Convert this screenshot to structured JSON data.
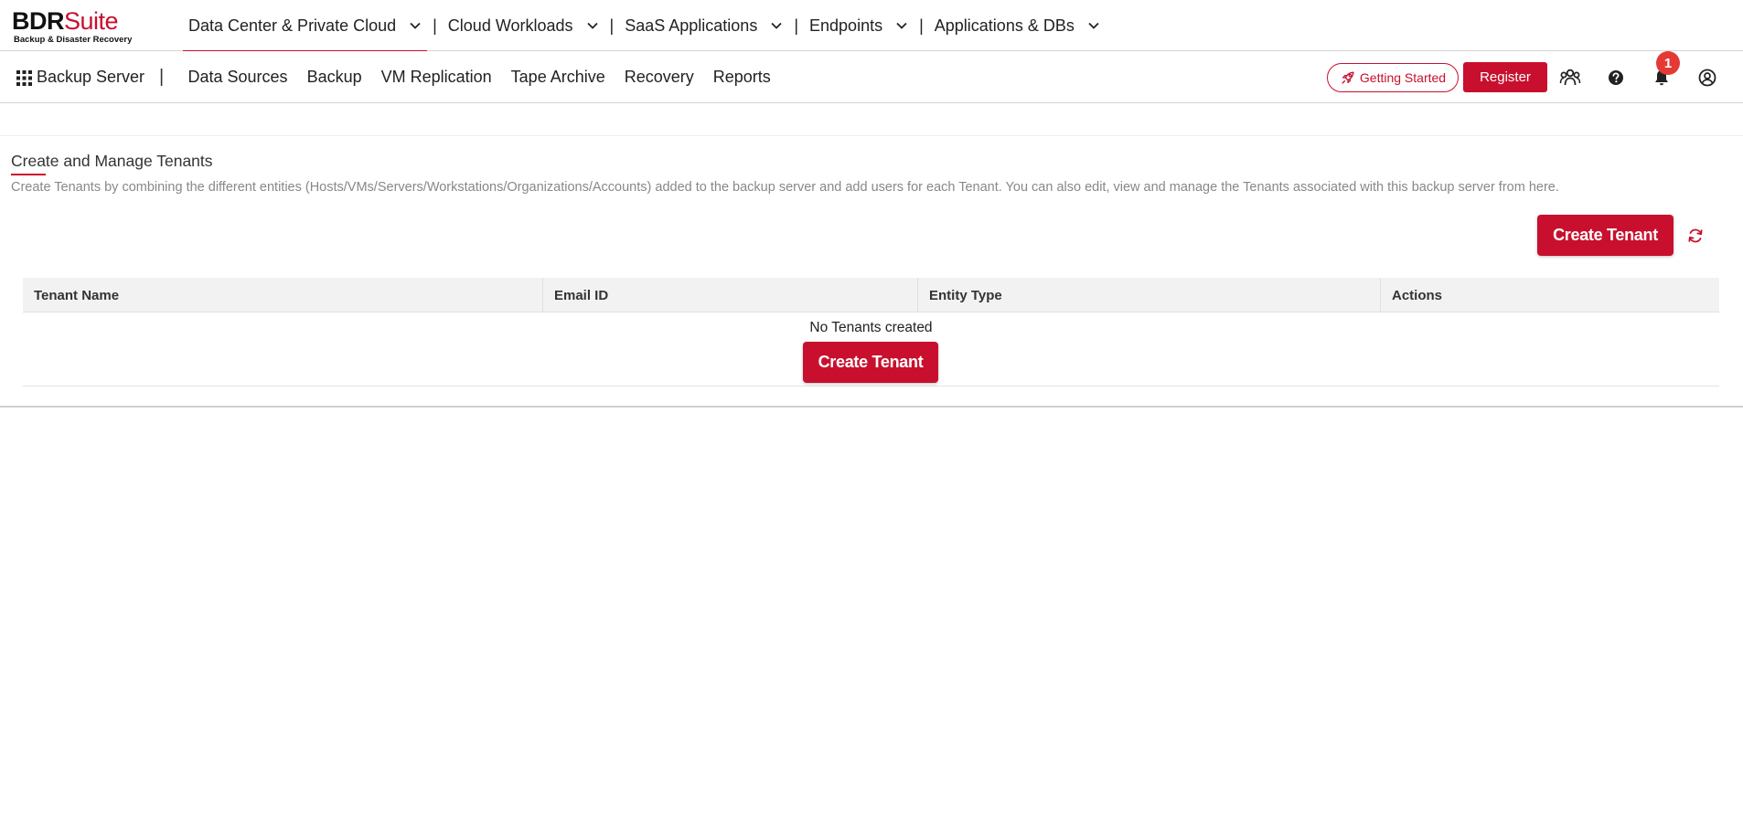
{
  "brand": {
    "name_part1": "BDR",
    "name_part2": "Suite",
    "tagline": "Backup & Disaster Recovery"
  },
  "top_nav": {
    "items": [
      {
        "label": "Data Center & Private Cloud",
        "active": true
      },
      {
        "label": "Cloud Workloads",
        "active": false
      },
      {
        "label": "SaaS Applications",
        "active": false
      },
      {
        "label": "Endpoints",
        "active": false
      },
      {
        "label": "Applications & DBs",
        "active": false
      }
    ],
    "separator": "|"
  },
  "sub_nav": {
    "server_label": "Backup Server",
    "separator": "|",
    "items": [
      "Data Sources",
      "Backup",
      "VM Replication",
      "Tape Archive",
      "Recovery",
      "Reports"
    ],
    "getting_started_label": "Getting Started",
    "register_label": "Register",
    "notification_count": "1",
    "icons": [
      "users-icon",
      "help-icon",
      "bell-icon",
      "user-account-icon"
    ]
  },
  "page": {
    "title": "Create and Manage Tenants",
    "description": "Create Tenants by combining the different entities (Hosts/VMs/Servers/Workstations/Organizations/Accounts) added to the backup server and add users for each Tenant. You can also edit, view and manage the Tenants associated with this backup server from here.",
    "create_button_label": "Create Tenant"
  },
  "table": {
    "columns": [
      "Tenant Name",
      "Email ID",
      "Entity Type",
      "Actions"
    ],
    "empty_message": "No Tenants created",
    "empty_create_label": "Create Tenant"
  },
  "colors": {
    "accent": "#c8102e",
    "badge": "#e53935",
    "header_bg": "#f2f2f2"
  }
}
